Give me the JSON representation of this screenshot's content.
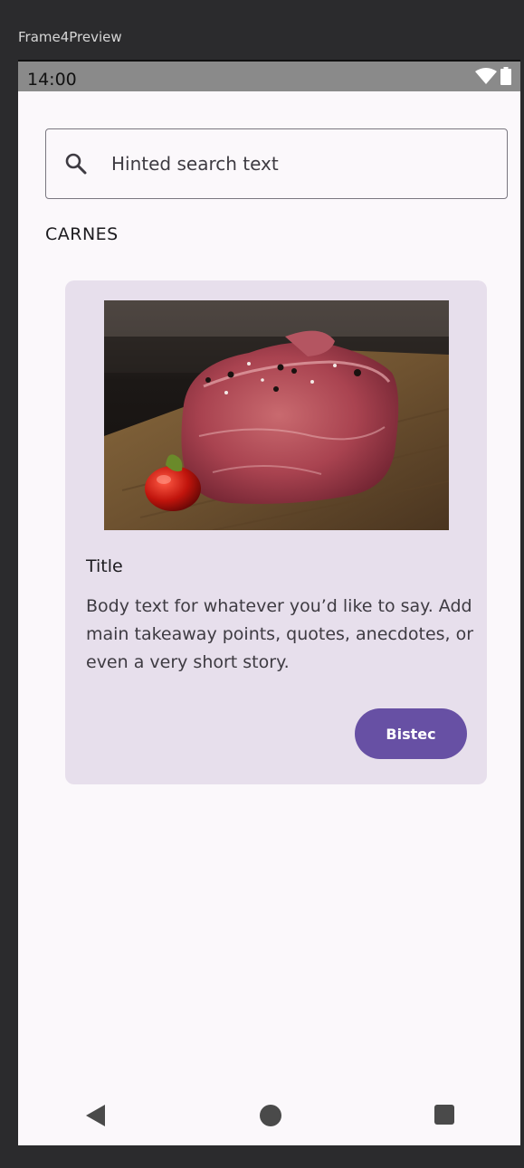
{
  "frame": {
    "label": "Frame4Preview"
  },
  "status_bar": {
    "time": "14:00",
    "icons": [
      "wifi-icon",
      "battery-icon"
    ]
  },
  "search": {
    "placeholder": "Hinted search text",
    "value": "",
    "icon": "search-icon"
  },
  "section": {
    "title": "CARNES"
  },
  "card": {
    "image_subject": "raw steak on wooden board",
    "title": "Title",
    "body": "Body text for whatever you’d like to say. Add main takeaway points, quotes, anecdotes, or even a very short story.",
    "button_label": "Bistec"
  },
  "nav": {
    "icons": [
      "back-icon",
      "home-icon",
      "recent-apps-icon"
    ]
  },
  "colors": {
    "primary": "#6750a4",
    "card_background": "#e7dfec",
    "surface": "#fbf8fb",
    "status_bar": "#8a8a8a"
  }
}
